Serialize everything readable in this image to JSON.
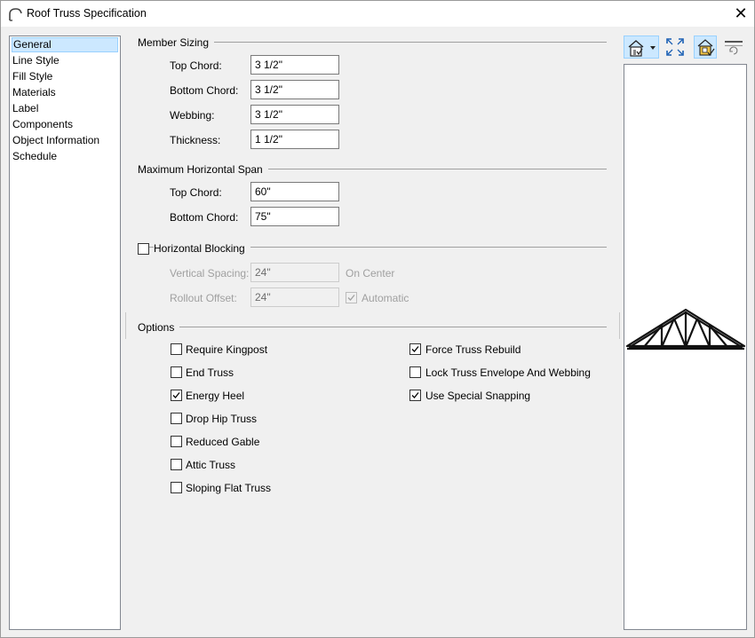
{
  "window": {
    "title": "Roof Truss Specification",
    "close_glyph": "✕",
    "icon": "arc-icon"
  },
  "nav": {
    "items": [
      {
        "label": "General",
        "selected": true
      },
      {
        "label": "Line Style"
      },
      {
        "label": "Fill Style"
      },
      {
        "label": "Materials"
      },
      {
        "label": "Label"
      },
      {
        "label": "Components"
      },
      {
        "label": "Object Information"
      },
      {
        "label": "Schedule"
      }
    ]
  },
  "member_sizing": {
    "title": "Member Sizing",
    "top_chord_label": "Top Chord:",
    "top_chord_value": "3 1/2\"",
    "bottom_chord_label": "Bottom Chord:",
    "bottom_chord_value": "3 1/2\"",
    "webbing_label": "Webbing:",
    "webbing_value": "3 1/2\"",
    "thickness_label": "Thickness:",
    "thickness_value": "1 1/2\""
  },
  "max_span": {
    "title": "Maximum Horizontal Span",
    "top_chord_label": "Top Chord:",
    "top_chord_value": "60\"",
    "bottom_chord_label": "Bottom Chord:",
    "bottom_chord_value": "75\""
  },
  "blocking": {
    "title": "Horizontal Blocking",
    "checked": false,
    "vertical_spacing_label": "Vertical Spacing:",
    "vertical_spacing_value": "24\"",
    "on_center_label": "On Center",
    "rollout_offset_label": "Rollout Offset:",
    "rollout_offset_value": "24\"",
    "automatic_label": "Automatic",
    "automatic_checked": true
  },
  "options": {
    "title": "Options",
    "left": [
      {
        "label": "Require Kingpost",
        "checked": false
      },
      {
        "label": "End Truss",
        "checked": false
      },
      {
        "label": "Energy Heel",
        "checked": true
      },
      {
        "label": "Drop Hip Truss",
        "checked": false
      },
      {
        "label": "Reduced Gable",
        "checked": false
      },
      {
        "label": "Attic Truss",
        "checked": false
      },
      {
        "label": "Sloping Flat Truss",
        "checked": false
      }
    ],
    "right": [
      {
        "label": "Force Truss Rebuild",
        "checked": true
      },
      {
        "label": "Lock Truss Envelope And Webbing",
        "checked": false
      },
      {
        "label": "Use Special Snapping",
        "checked": true
      }
    ]
  },
  "toolbar": {
    "tools": [
      "house-view-dropdown-icon",
      "fit-to-window-icon",
      "show-materials-icon",
      "reset-view-icon"
    ]
  },
  "colors": {
    "selection_bg": "#cce8ff",
    "selection_border": "#99d1ff",
    "dialog_bg": "#f0f0f0"
  }
}
